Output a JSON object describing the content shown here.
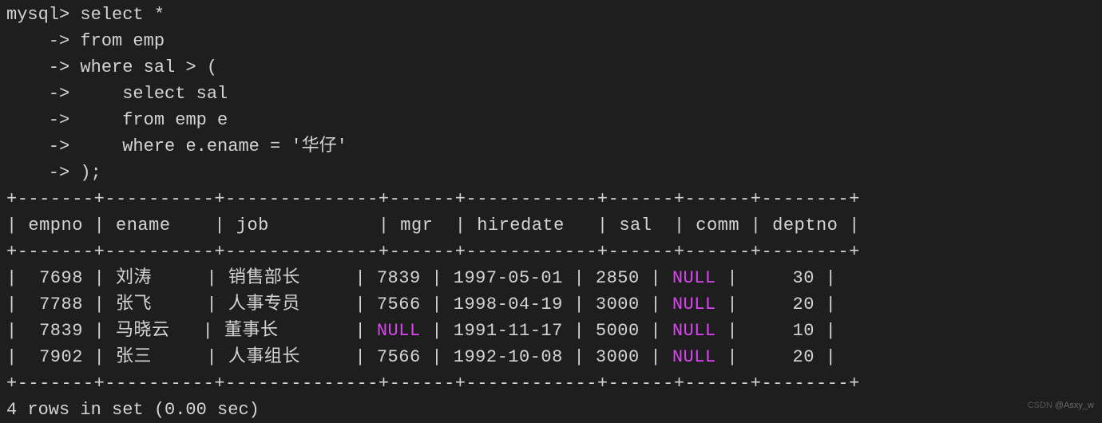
{
  "prompt_main": "mysql> ",
  "prompt_cont": "    -> ",
  "query": [
    "select *",
    "from emp",
    "where sal > (",
    "    select sal",
    "    from emp e",
    "    where e.ename = '华仔'",
    ");"
  ],
  "table_border": "+-------+----------+--------------+------+------------+------+------+--------+",
  "table_header": "| empno | ename    | job          | mgr  | hiredate   | sal  | comm | deptno |",
  "rows": [
    {
      "empno": "7698",
      "ename": "刘涛",
      "job": "销售部长",
      "mgr": "7839",
      "hiredate": "1997-05-01",
      "sal": "2850",
      "comm": "NULL",
      "deptno": "30"
    },
    {
      "empno": "7788",
      "ename": "张飞",
      "job": "人事专员",
      "mgr": "7566",
      "hiredate": "1998-04-19",
      "sal": "3000",
      "comm": "NULL",
      "deptno": "20"
    },
    {
      "empno": "7839",
      "ename": "马晓云",
      "job": "董事长",
      "mgr": "NULL",
      "hiredate": "1991-11-17",
      "sal": "5000",
      "comm": "NULL",
      "deptno": "10"
    },
    {
      "empno": "7902",
      "ename": "张三",
      "job": "人事组长",
      "mgr": "7566",
      "hiredate": "1992-10-08",
      "sal": "3000",
      "comm": "NULL",
      "deptno": "20"
    }
  ],
  "footer": "4 rows in set (0.00 sec)",
  "watermark_left": "CSDN ",
  "watermark_right": "@Asxy_w"
}
